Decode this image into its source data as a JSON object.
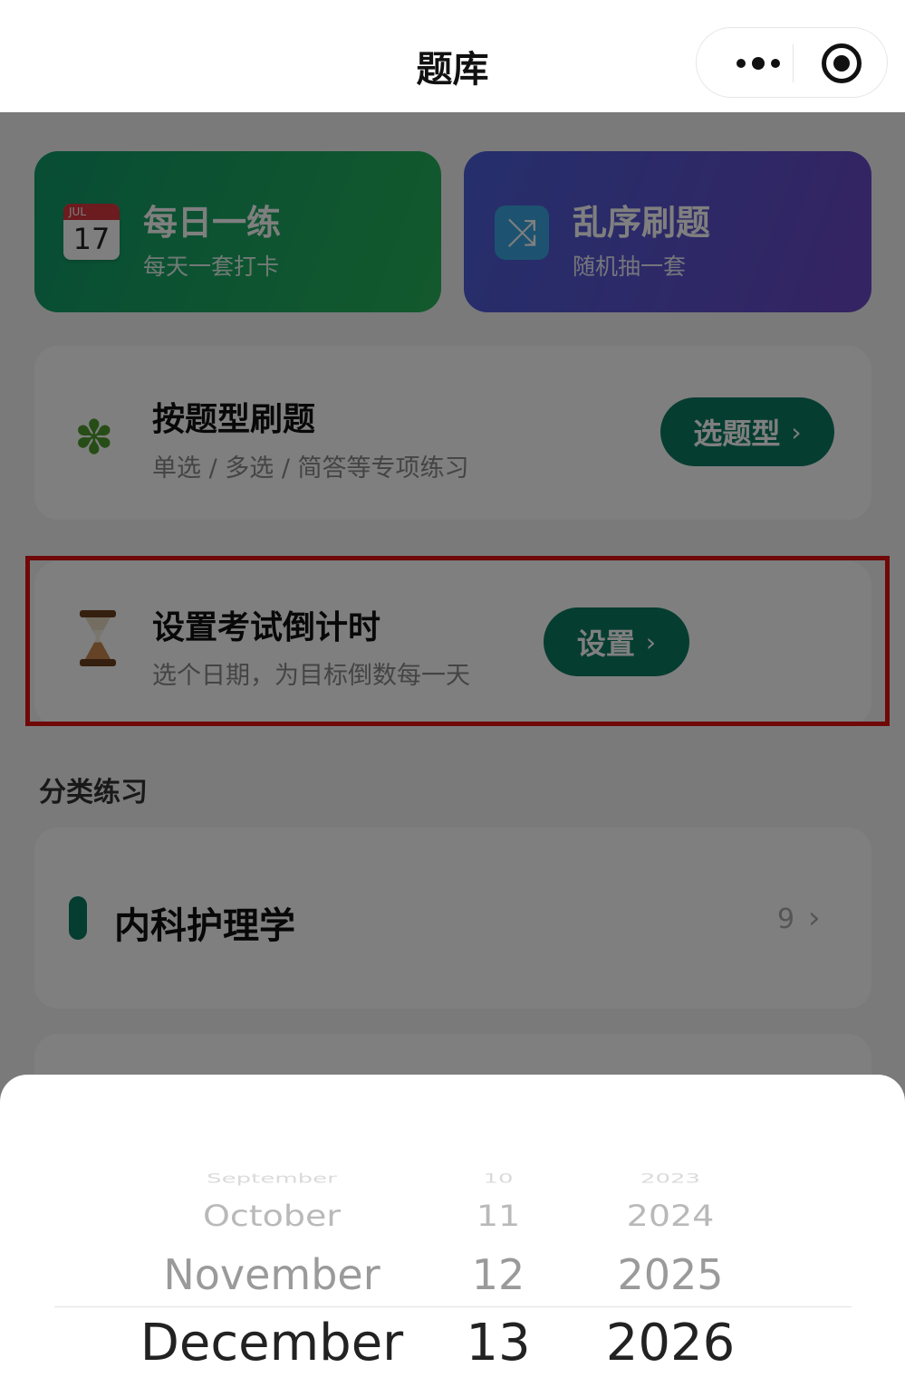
{
  "navbar": {
    "title": "题库",
    "more_icon": "more-dots-icon",
    "close_icon": "target-close-icon"
  },
  "cards": {
    "daily": {
      "icon": "calendar-icon",
      "icon_month": "JUL",
      "icon_day": "17",
      "title": "每日一练",
      "subtitle": "每天一套打卡",
      "color": "#0f9a6a"
    },
    "random": {
      "icon": "shuffle-icon",
      "title": "乱序刷题",
      "subtitle": "随机抽一套",
      "color": "#5a52d0"
    }
  },
  "by_type": {
    "icon": "puzzle-icon",
    "title": "按题型刷题",
    "subtitle": "单选 / 多选 / 简答等专项练习",
    "button_label": "选题型",
    "button_chevron": "›"
  },
  "countdown": {
    "icon": "hourglass-icon",
    "title": "设置考试倒计时",
    "subtitle": "选个日期，为目标倒数每一天",
    "button_label": "设置",
    "button_chevron": "›"
  },
  "section": {
    "title": "分类练习"
  },
  "categories": [
    {
      "label": "内科护理学",
      "count": "9",
      "chevron": "›"
    }
  ],
  "picker": {
    "months": [
      "September",
      "October",
      "November",
      "December"
    ],
    "days": [
      "10",
      "11",
      "12",
      "13"
    ],
    "years": [
      "2023",
      "2024",
      "2025",
      "2026"
    ],
    "selected": {
      "month": "December",
      "day": "13",
      "year": "2026"
    }
  },
  "colors": {
    "accent": "#0c7a63",
    "highlight": "#e01010"
  }
}
